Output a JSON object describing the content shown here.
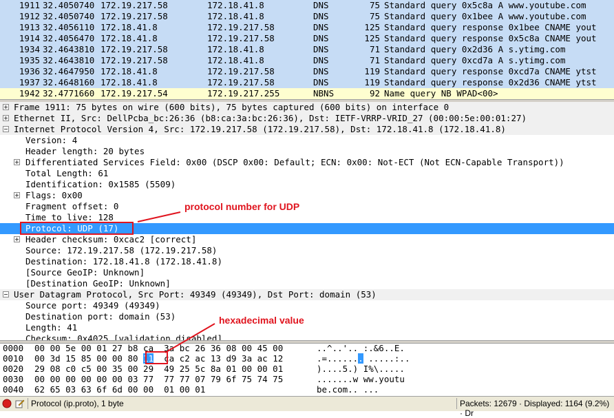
{
  "packets": [
    {
      "no": "1911",
      "time": "32.4050740",
      "src": "172.19.217.58",
      "dst": "172.18.41.8",
      "proto": "DNS",
      "len": "75",
      "info": "Standard query 0x5c8a  A www.youtube.com",
      "bg": "#c6dcf5"
    },
    {
      "no": "1912",
      "time": "32.4050740",
      "src": "172.19.217.58",
      "dst": "172.18.41.8",
      "proto": "DNS",
      "len": "75",
      "info": "Standard query 0x1bee  A www.youtube.com",
      "bg": "#c6dcf5"
    },
    {
      "no": "1913",
      "time": "32.4056110",
      "src": "172.18.41.8",
      "dst": "172.19.217.58",
      "proto": "DNS",
      "len": "125",
      "info": "Standard query response 0x1bee  CNAME yout",
      "bg": "#c6dcf5"
    },
    {
      "no": "1914",
      "time": "32.4056470",
      "src": "172.18.41.8",
      "dst": "172.19.217.58",
      "proto": "DNS",
      "len": "125",
      "info": "Standard query response 0x5c8a  CNAME yout",
      "bg": "#c6dcf5"
    },
    {
      "no": "1934",
      "time": "32.4643810",
      "src": "172.19.217.58",
      "dst": "172.18.41.8",
      "proto": "DNS",
      "len": "71",
      "info": "Standard query 0x2d36  A s.ytimg.com",
      "bg": "#c6dcf5"
    },
    {
      "no": "1935",
      "time": "32.4643810",
      "src": "172.19.217.58",
      "dst": "172.18.41.8",
      "proto": "DNS",
      "len": "71",
      "info": "Standard query 0xcd7a  A s.ytimg.com",
      "bg": "#c6dcf5"
    },
    {
      "no": "1936",
      "time": "32.4647950",
      "src": "172.18.41.8",
      "dst": "172.19.217.58",
      "proto": "DNS",
      "len": "119",
      "info": "Standard query response 0xcd7a  CNAME ytst",
      "bg": "#c6dcf5"
    },
    {
      "no": "1937",
      "time": "32.4648160",
      "src": "172.18.41.8",
      "dst": "172.19.217.58",
      "proto": "DNS",
      "len": "119",
      "info": "Standard query response 0x2d36  CNAME ytst",
      "bg": "#c6dcf5"
    },
    {
      "no": "1942",
      "time": "32.4771660",
      "src": "172.19.217.54",
      "dst": "172.19.217.255",
      "proto": "NBNS",
      "len": "92",
      "info": "Name query NB WPAD<00>",
      "bg": "#fefed0"
    }
  ],
  "details": [
    {
      "text": "Frame 1911: 75 bytes on wire (600 bits), 75 bytes captured (600 bits) on interface 0",
      "level": 0,
      "expander": "plus",
      "header": true
    },
    {
      "text": "Ethernet II, Src: DellPcba_bc:26:36 (b8:ca:3a:bc:26:36), Dst: IETF-VRRP-VRID_27 (00:00:5e:00:01:27)",
      "level": 0,
      "expander": "plus",
      "header": true
    },
    {
      "text": "Internet Protocol Version 4, Src: 172.19.217.58 (172.19.217.58), Dst: 172.18.41.8 (172.18.41.8)",
      "level": 0,
      "expander": "minus",
      "header": true
    },
    {
      "text": "Version: 4",
      "level": 1,
      "expander": ""
    },
    {
      "text": "Header length: 20 bytes",
      "level": 1,
      "expander": ""
    },
    {
      "text": "Differentiated Services Field: 0x00 (DSCP 0x00: Default; ECN: 0x00: Not-ECT (Not ECN-Capable Transport))",
      "level": 1,
      "expander": "plus"
    },
    {
      "text": "Total Length: 61",
      "level": 1,
      "expander": ""
    },
    {
      "text": "Identification: 0x1585 (5509)",
      "level": 1,
      "expander": ""
    },
    {
      "text": "Flags: 0x00",
      "level": 1,
      "expander": "plus"
    },
    {
      "text": "Fragment offset: 0",
      "level": 1,
      "expander": ""
    },
    {
      "text": "Time to live: 128",
      "level": 1,
      "expander": ""
    },
    {
      "text": "Protocol: UDP (17)",
      "level": 1,
      "expander": "",
      "selected": true
    },
    {
      "text": "Header checksum: 0xcac2 [correct]",
      "level": 1,
      "expander": "plus"
    },
    {
      "text": "Source: 172.19.217.58 (172.19.217.58)",
      "level": 1,
      "expander": ""
    },
    {
      "text": "Destination: 172.18.41.8 (172.18.41.8)",
      "level": 1,
      "expander": ""
    },
    {
      "text": "[Source GeoIP: Unknown]",
      "level": 1,
      "expander": ""
    },
    {
      "text": "[Destination GeoIP: Unknown]",
      "level": 1,
      "expander": ""
    },
    {
      "text": "User Datagram Protocol, Src Port: 49349 (49349), Dst Port: domain (53)",
      "level": 0,
      "expander": "minus",
      "header": true
    },
    {
      "text": "Source port: 49349 (49349)",
      "level": 1,
      "expander": ""
    },
    {
      "text": "Destination port: domain (53)",
      "level": 1,
      "expander": ""
    },
    {
      "text": "Length: 41",
      "level": 1,
      "expander": ""
    },
    {
      "text": "Checksum: 0x4025 [validation disabled]",
      "level": 1,
      "expander": ""
    }
  ],
  "bytes": [
    {
      "offset": "0000",
      "hex_pre": "00 00 5e 00 01 27 b8 ca  3a bc 26 36 08 00 45 00",
      "hex_hl": "",
      "hex_post": "",
      "ascii_pre": "..^..'.. :.&6..E.",
      "ascii_hl": "",
      "ascii_post": ""
    },
    {
      "offset": "0010",
      "hex_pre": "00 3d 15 85 00 00 80 ",
      "hex_hl": "11",
      "hex_post": "  ca c2 ac 13 d9 3a ac 12",
      "ascii_pre": ".=......",
      "ascii_hl": ".",
      "ascii_post": " .....:.."
    },
    {
      "offset": "0020",
      "hex_pre": "29 08 c0 c5 00 35 00 29  49 25 5c 8a 01 00 00 01",
      "hex_hl": "",
      "hex_post": "",
      "ascii_pre": ")....5.) I%\\.....",
      "ascii_hl": "",
      "ascii_post": ""
    },
    {
      "offset": "0030",
      "hex_pre": "00 00 00 00 00 00 03 77  77 77 07 79 6f 75 74 75",
      "hex_hl": "",
      "hex_post": "",
      "ascii_pre": ".......w ww.youtu",
      "ascii_hl": "",
      "ascii_post": ""
    },
    {
      "offset": "0040",
      "hex_pre": "62 65 03 63 6f 6d 00 00  01 00 01",
      "hex_hl": "",
      "hex_post": "",
      "ascii_pre": "be.com.. ...",
      "ascii_hl": "",
      "ascii_post": ""
    }
  ],
  "status": {
    "field_text": "Protocol (ip.proto), 1 byte",
    "packets_text": "Packets: 12679 · Displayed: 1164 (9.2%) · Dr"
  },
  "annotations": {
    "protocol_label": "protocol number for UDP",
    "hex_label": "hexadecimal value",
    "color": "#e0141e"
  },
  "icons": {
    "status_error": "stop-icon",
    "status_edit": "edit-capture-comment-icon"
  }
}
